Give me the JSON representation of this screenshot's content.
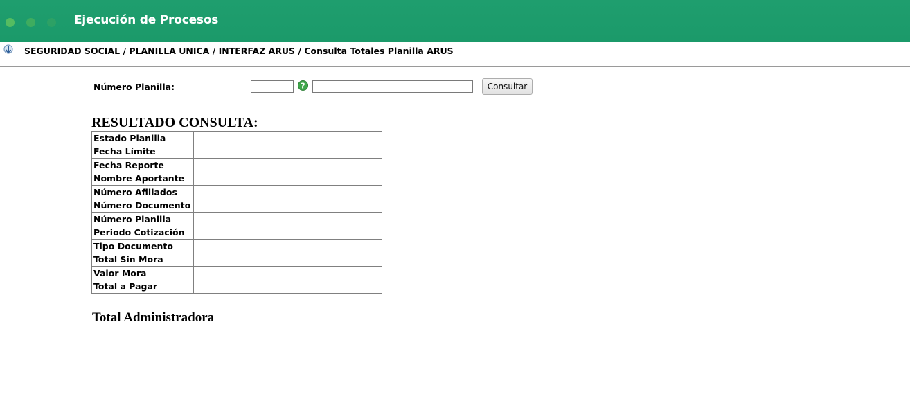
{
  "header": {
    "title": "Ejecución de Procesos",
    "colors": {
      "background": "#1f9e6e",
      "text": "#ffffff"
    }
  },
  "breadcrumb": {
    "icon": "arrow-down-icon",
    "text": "SEGURIDAD SOCIAL / PLANILLA UNICA / INTERFAZ ARUS / Consulta Totales Planilla ARUS"
  },
  "form": {
    "label": "Número Planilla:",
    "code_value": "",
    "number_value": "",
    "help_icon": "help-icon",
    "submit_label": "Consultar"
  },
  "result": {
    "title": "RESULTADO CONSULTA:",
    "rows": [
      {
        "label": "Estado Planilla",
        "value": ""
      },
      {
        "label": "Fecha Límite",
        "value": ""
      },
      {
        "label": "Fecha Reporte",
        "value": ""
      },
      {
        "label": "Nombre Aportante",
        "value": ""
      },
      {
        "label": "Número Afiliados",
        "value": ""
      },
      {
        "label": "Número Documento",
        "value": ""
      },
      {
        "label": "Número Planilla",
        "value": ""
      },
      {
        "label": "Periodo Cotización",
        "value": ""
      },
      {
        "label": "Tipo Documento",
        "value": ""
      },
      {
        "label": "Total Sin Mora",
        "value": ""
      },
      {
        "label": "Valor Mora",
        "value": ""
      },
      {
        "label": "Total a Pagar",
        "value": ""
      }
    ]
  },
  "total_admin": {
    "title": "Total Administradora"
  }
}
